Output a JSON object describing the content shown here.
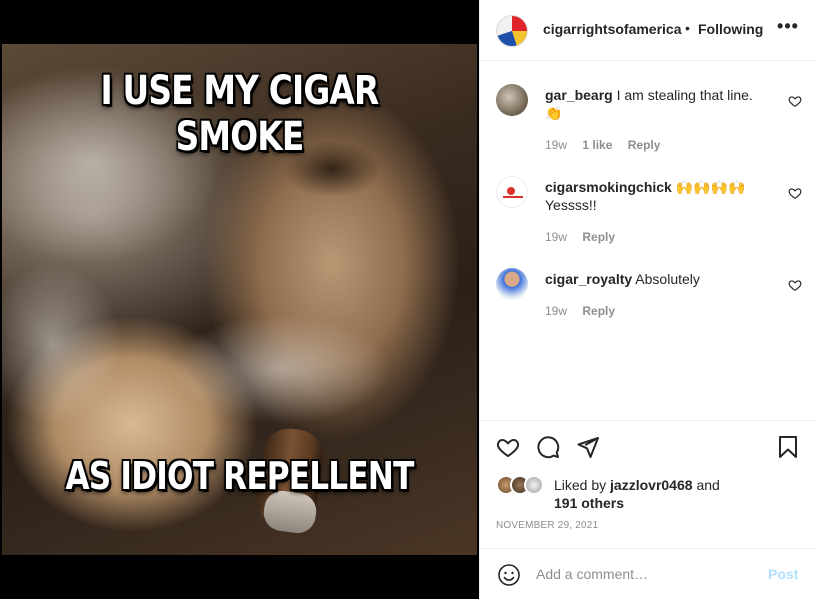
{
  "post": {
    "meme_top": "I USE MY CIGAR SMOKE",
    "meme_bottom": "AS IDIOT REPELLENT",
    "image_alt": "Man smoking a cigar with meme text"
  },
  "header": {
    "username": "cigarrightsofamerica",
    "separator": "•",
    "follow_label": "Following",
    "more_label": "•••"
  },
  "comments": [
    {
      "username": "gar_bearg",
      "text": "I am stealing that line.",
      "emoji": "👏",
      "time": "19w",
      "likes": "1 like",
      "reply": "Reply"
    },
    {
      "username": "cigarsmokingchick",
      "text": "🙌🙌🙌🙌",
      "text2": "Yessss!!",
      "time": "19w",
      "reply": "Reply"
    },
    {
      "username": "cigar_royalty",
      "text": "Absolutely",
      "time": "19w",
      "reply": "Reply"
    }
  ],
  "likes": {
    "prefix": "Liked by",
    "user": "jazzlovr0468",
    "conj": "and",
    "others": "191 others"
  },
  "date": "November 29, 2021",
  "add_comment": {
    "placeholder": "Add a comment…",
    "post_label": "Post"
  },
  "colors": {
    "text": "#262626",
    "muted": "#8e8e8e",
    "post_disabled": "#b2dffc",
    "divider": "#efefef"
  }
}
